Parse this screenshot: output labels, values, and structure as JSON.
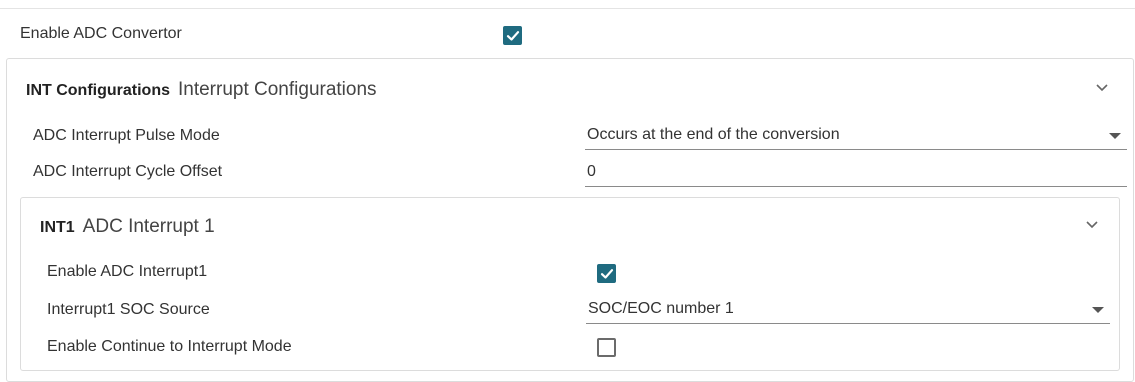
{
  "top": {
    "enable_adc_label": "Enable ADC Convertor",
    "enable_adc_checked": true
  },
  "int_config": {
    "code": "INT Configurations",
    "title": "Interrupt Configurations",
    "pulse_mode_label": "ADC Interrupt Pulse Mode",
    "pulse_mode_value": "Occurs at the end of the conversion",
    "cycle_offset_label": "ADC Interrupt Cycle Offset",
    "cycle_offset_value": "0"
  },
  "int1": {
    "code": "INT1",
    "title": "ADC Interrupt 1",
    "enable_label": "Enable ADC Interrupt1",
    "enable_checked": true,
    "soc_source_label": "Interrupt1 SOC Source",
    "soc_source_value": "SOC/EOC number 1",
    "continue_label": "Enable Continue to Interrupt Mode",
    "continue_checked": false
  },
  "colors": {
    "accent": "#1f6b80",
    "border": "#dcdcdc"
  },
  "icons": [
    "check-icon",
    "chevron-down-icon",
    "dropdown-arrow-icon"
  ]
}
